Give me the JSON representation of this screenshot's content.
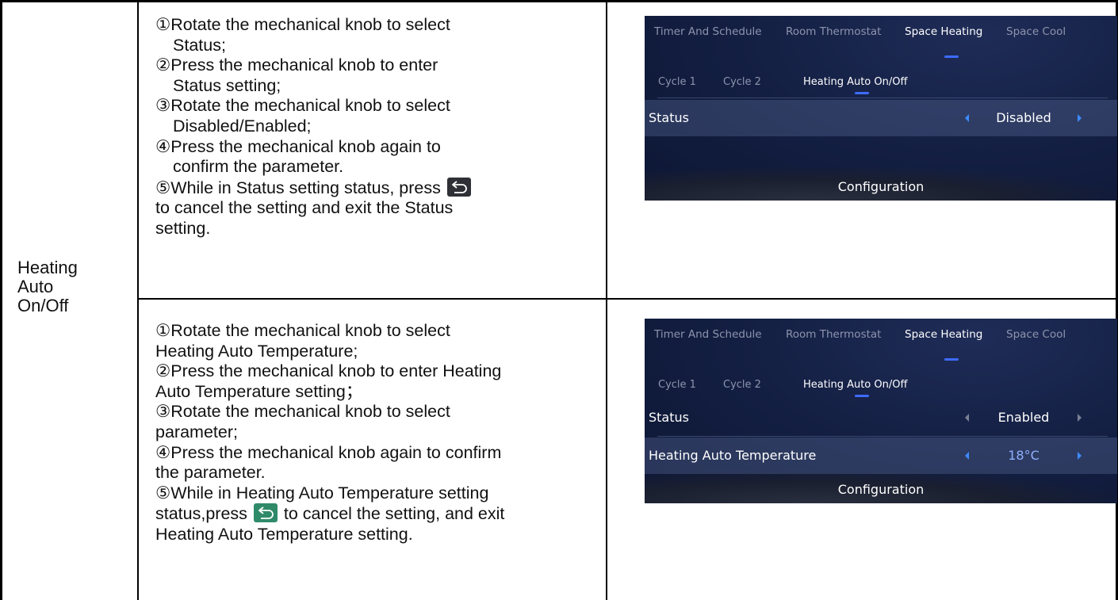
{
  "row_label": [
    "Heating",
    "Auto",
    "On/Off"
  ],
  "section1": {
    "steps": [
      {
        "lines": [
          "①Rotate the mechanical knob to select",
          "Status;"
        ]
      },
      {
        "lines": [
          "②Press the mechanical knob to enter",
          "Status setting;"
        ]
      },
      {
        "lines": [
          "③Rotate the mechanical knob to select",
          "Disabled/Enabled;"
        ]
      },
      {
        "lines": [
          "④Press the mechanical knob again to",
          "confirm the parameter."
        ]
      }
    ],
    "step5_pre": "⑤While in Status setting status, press",
    "step5_post": "to cancel the setting and exit the Status",
    "step5_end": "setting."
  },
  "section2": {
    "steps": [
      "①Rotate the mechanical knob to select",
      "Heating Auto Temperature;",
      "②Press the mechanical knob to enter Heating",
      "Auto Temperature setting；",
      "③Rotate the mechanical knob to select",
      "parameter;",
      "④Press the mechanical knob again to confirm",
      "the parameter.",
      "⑤While in Heating Auto Temperature setting"
    ],
    "step5_pre": "status,press",
    "step5_post": "to cancel the setting, and exit",
    "step5_end": "Heating Auto Temperature setting."
  },
  "screen": {
    "tabs": [
      "Timer And Schedule",
      "Room Thermostat",
      "Space Heating",
      "Space Cool"
    ],
    "subtabs": [
      "Cycle 1",
      "Cycle 2",
      "Heating Auto On/Off"
    ],
    "footer": "Configuration",
    "accent": "#3d6cff"
  },
  "screen1": {
    "rows": [
      {
        "name": "Status",
        "value": "Disabled"
      }
    ]
  },
  "screen2": {
    "rows": [
      {
        "name": "Status",
        "value": "Enabled"
      },
      {
        "name": "Heating Auto Temperature",
        "value": "18°C"
      }
    ]
  },
  "icons": {
    "back": "back-arrow-icon"
  }
}
